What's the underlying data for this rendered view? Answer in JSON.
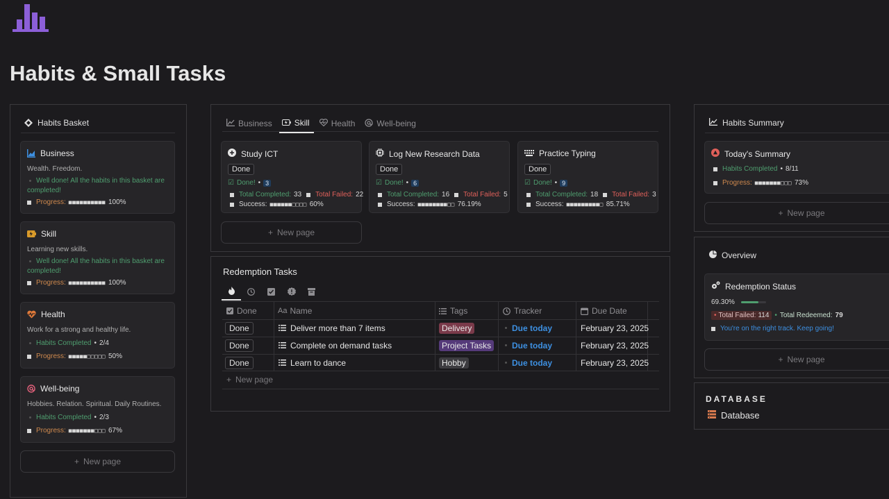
{
  "page": {
    "title": "Habits & Small Tasks"
  },
  "colors": {
    "accent": "#8c5fd8",
    "green": "#4f9e6f",
    "orange": "#d08a4e",
    "red": "#e0605a",
    "blue": "#3d8fe0"
  },
  "habits_basket": {
    "title": "Habits Basket",
    "new_page": "New page",
    "cards": [
      {
        "icon": "bar-chart-icon",
        "title": "Business",
        "desc": "Wealth. Freedom.",
        "status_line1": "Well done! All the habits in this basket are",
        "status_line2": "completed!",
        "progress_label": "Progress:",
        "progress_bar": "■■■■■■■■■■",
        "progress_pct": "100%"
      },
      {
        "icon": "battery-icon",
        "title": "Skill",
        "desc": "Learning new skills.",
        "status_line1": "Well done! All the habits in this basket are",
        "status_line2": "completed!",
        "progress_label": "Progress:",
        "progress_bar": "■■■■■■■■■■",
        "progress_pct": "100%"
      },
      {
        "icon": "heartbeat-icon",
        "title": "Health",
        "desc": "Work for a strong and healthy life.",
        "habits_label": "Habits Completed",
        "habits_count": "2/4",
        "progress_label": "Progress:",
        "progress_bar": "■■■■■□□□□□",
        "progress_pct": "50%"
      },
      {
        "icon": "at-icon",
        "title": "Well-being",
        "desc": "Hobbies. Relation. Spiritual. Daily Routines.",
        "habits_label": "Habits Completed",
        "habits_count": "2/3",
        "progress_label": "Progress:",
        "progress_bar": "■■■■■■■□□□",
        "progress_pct": "67%"
      }
    ]
  },
  "tabs": [
    {
      "label": "Business",
      "icon": "bar-chart-icon"
    },
    {
      "label": "Skill",
      "icon": "battery-icon"
    },
    {
      "label": "Health",
      "icon": "heartbeat-icon"
    },
    {
      "label": "Well-being",
      "icon": "at-icon"
    }
  ],
  "skill_cards": [
    {
      "icon": "plus-circle-icon",
      "title": "Study ICT",
      "status": "Done",
      "done_label": "Done!",
      "done_count": "3",
      "completed_label": "Total Completed:",
      "completed": "33",
      "failed_label": "Total Failed:",
      "failed": "22",
      "success_label": "Success:",
      "success_bar": "■■■■■■□□□□",
      "success_pct": "60%"
    },
    {
      "icon": "chip-icon",
      "title": "Log New Research Data",
      "status": "Done",
      "done_label": "Done!",
      "done_count": "6",
      "completed_label": "Total Completed:",
      "completed": "16",
      "failed_label": "Total Failed:",
      "failed": "5",
      "success_label": "Success:",
      "success_bar": "■■■■■■■■□□",
      "success_pct": "76.19%"
    },
    {
      "icon": "keyboard-icon",
      "title": "Practice Typing",
      "status": "Done",
      "done_label": "Done!",
      "done_count": "9",
      "completed_label": "Total Completed:",
      "completed": "18",
      "failed_label": "Total Failed:",
      "failed": "3",
      "success_label": "Success:",
      "success_bar": "■■■■■■■■■□",
      "success_pct": "85.71%"
    }
  ],
  "skill_new_page": "New page",
  "redemption": {
    "title": "Redemption Tasks",
    "columns": [
      "Done",
      "Name",
      "Tags",
      "Tracker",
      "Due Date"
    ],
    "rows": [
      {
        "done": "Done",
        "name": "Deliver more than 7 items",
        "tag": "Delivery",
        "tag_color": "#7a3a4a",
        "tracker": "Due today",
        "due": "February 23, 2025"
      },
      {
        "done": "Done",
        "name": "Complete on demand tasks",
        "tag": "Project Tasks",
        "tag_color": "#553a7a",
        "tracker": "Due today",
        "due": "February 23, 2025"
      },
      {
        "done": "Done",
        "name": "Learn to dance",
        "tag": "Hobby",
        "tag_color": "#3d3c40",
        "tracker": "Due today",
        "due": "February 23, 2025"
      }
    ],
    "new_page": "New page"
  },
  "habits_summary": {
    "title": "Habits Summary",
    "card_title": "Today's Summary",
    "habits_label": "Habits Completed",
    "habits_count": "8/11",
    "progress_label": "Progress:",
    "progress_bar": "■■■■■■■□□□",
    "progress_pct": "73%",
    "new_page": "New page"
  },
  "overview": {
    "title": "Overview",
    "card_title": "Redemption Status",
    "pct": "69.30%",
    "pct_fraction": 0.693,
    "failed_label": "Total Failed:",
    "failed": "114",
    "redeemed_label": "Total Redeemed:",
    "redeemed": "79",
    "message": "You're on the right track. Keep going!",
    "new_page": "New page"
  },
  "database": {
    "heading": "DATABASE",
    "link": "Database"
  }
}
